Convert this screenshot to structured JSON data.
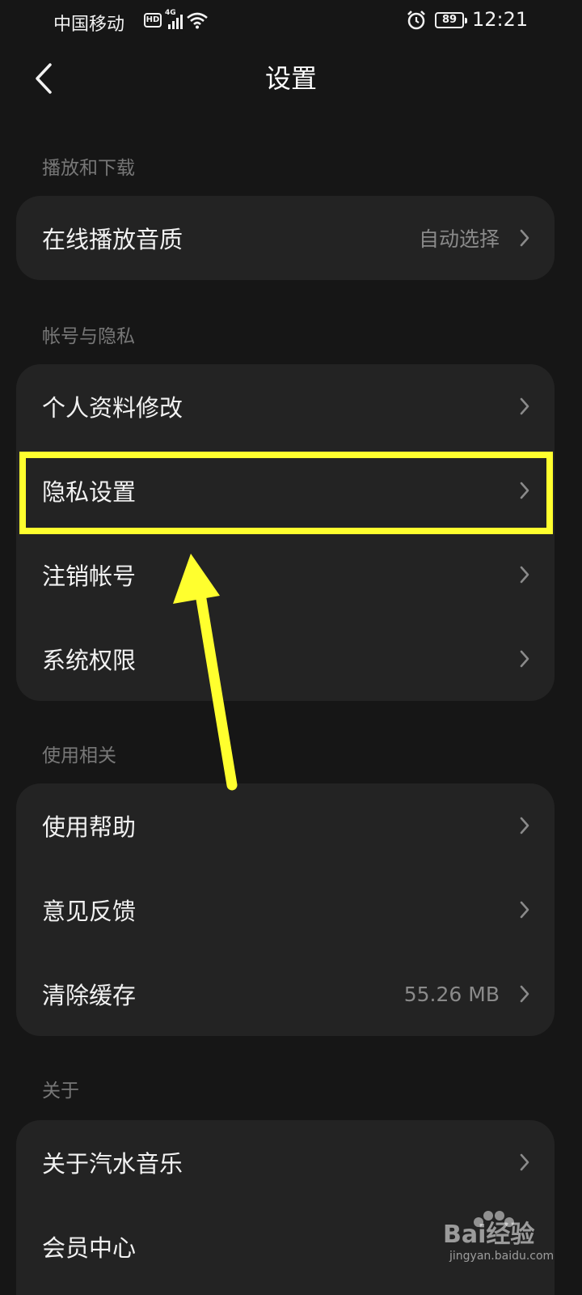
{
  "status_bar": {
    "carrier": "中国移动",
    "hd_badge": "HD",
    "network": "4G",
    "battery": "89",
    "time": "12:21"
  },
  "header": {
    "title": "设置"
  },
  "sections": {
    "playback": {
      "label": "播放和下载",
      "items": [
        {
          "label": "在线播放音质",
          "value": "自动选择"
        }
      ]
    },
    "account": {
      "label": "帐号与隐私",
      "items": [
        {
          "label": "个人资料修改"
        },
        {
          "label": "隐私设置"
        },
        {
          "label": "注销帐号"
        },
        {
          "label": "系统权限"
        }
      ]
    },
    "usage": {
      "label": "使用相关",
      "items": [
        {
          "label": "使用帮助"
        },
        {
          "label": "意见反馈"
        },
        {
          "label": "清除缓存",
          "value": "55.26 MB"
        }
      ]
    },
    "about": {
      "label": "关于",
      "items": [
        {
          "label": "关于汽水音乐"
        },
        {
          "label": "会员中心"
        }
      ]
    }
  },
  "colors": {
    "background": "#161616",
    "card": "#232323",
    "highlight": "#ffff2e"
  },
  "watermark": {
    "text": "Bai经验",
    "sub": "jingyan.baidu.com"
  }
}
